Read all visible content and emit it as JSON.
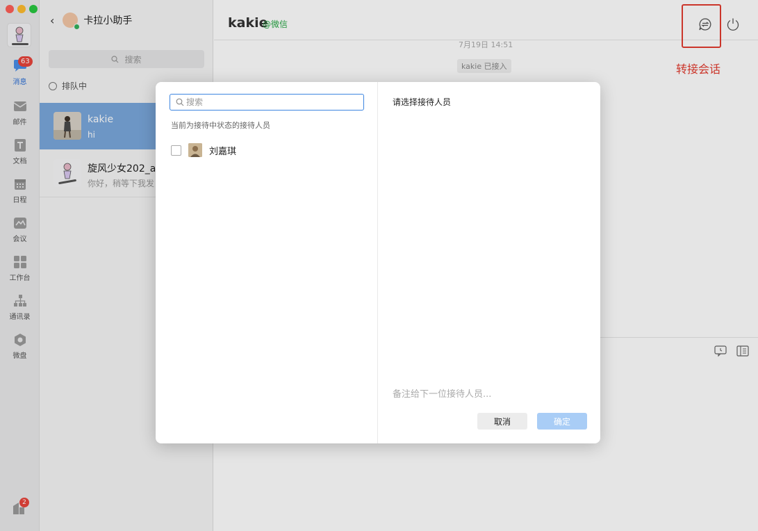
{
  "rail": {
    "messages_badge": "63",
    "items": [
      {
        "label": "消息"
      },
      {
        "label": "邮件"
      },
      {
        "label": "文档"
      },
      {
        "label": "日程"
      },
      {
        "label": "会议"
      },
      {
        "label": "工作台"
      },
      {
        "label": "通讯录"
      },
      {
        "label": "微盘"
      }
    ],
    "bottom_badge": "2"
  },
  "sessions": {
    "title": "卡拉小助手",
    "search_placeholder": "搜索",
    "queue_label": "排队中",
    "items": [
      {
        "name": "kakie",
        "preview": "hi"
      },
      {
        "name": "旋风少女202_a",
        "preview": "你好，稍等下我发"
      }
    ]
  },
  "chat": {
    "title": "kakie",
    "source": "@微信",
    "time": "7月19日 14:51",
    "system_msg": "kakie 已接入",
    "annotation": "转接会话"
  },
  "dialog": {
    "search_placeholder": "搜索",
    "hint": "当前为接待中状态的接待人员",
    "staff": [
      {
        "name": "刘嘉琪"
      }
    ],
    "right_title": "请选择接待人员",
    "note_placeholder": "备注给下一位接待人员...",
    "cancel_label": "取消",
    "confirm_label": "确定"
  },
  "colors": {
    "accent": "#3c85e0",
    "selected_session": "#7aa7dc",
    "annotation_red": "#e23c2f",
    "confirm_disabled": "#a9cdf6"
  }
}
